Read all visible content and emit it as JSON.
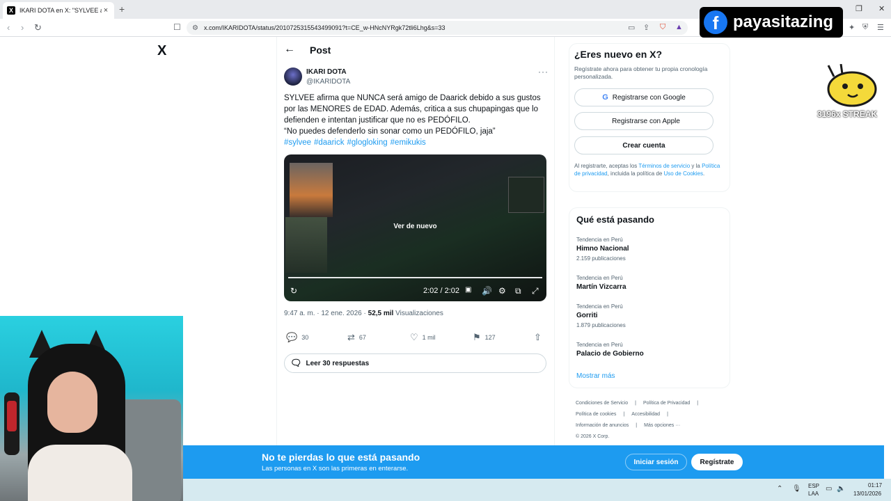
{
  "browser": {
    "tab_favicon": "X",
    "tab_title": "IKARI DOTA en X: \"SYLVEE afirma",
    "tab_close": "×",
    "new_tab": "+",
    "window_controls": [
      "—",
      "❐",
      "✕"
    ],
    "url": "x.com/IKARIDOTA/status/2010725315543499091?t=CE_w-HNcNYRgk72tli6Lhg&s=33"
  },
  "overlay": {
    "fb_letter": "f",
    "fb_name": "payasitazing",
    "streak": "3196x STREAK"
  },
  "x": {
    "logo": "X",
    "header": "Post",
    "author_name": "IKARI DOTA",
    "author_handle": "@IKARIDOTA",
    "more": "···",
    "text_lines": [
      "SYLVEE afirma que NUNCA será amigo de Daarick debido a sus gustos",
      "por las MENORES de EDAD. Además, critica a sus chupapingas que lo",
      "defienden e intentan justificar que no es PEDÓFILO.",
      "“No puedes defenderlo sin sonar como un PEDÓFILO, jaja”"
    ],
    "hashtags": [
      "#sylvee",
      "#daarick",
      "#glogloking",
      "#emikukis"
    ],
    "video": {
      "replay_label": "Ver de nuevo",
      "time": "2:02 / 2:02"
    },
    "meta_time": "9:47 a. m. · 12 ene. 2026 · ",
    "meta_views_count": "52,5 mil",
    "meta_views_label": " Visualizaciones",
    "actions": {
      "replies": "30",
      "retweets": "67",
      "likes": "1 mil",
      "bookmarks": "127"
    },
    "read_replies": "Leer 30 respuestas"
  },
  "sidebar": {
    "signup_title": "¿Eres nuevo en X?",
    "signup_sub": "Regístrate ahora para obtener tu propia cronología personalizada.",
    "google_btn": "Registrarse con Google",
    "apple_btn": "Registrarse con Apple",
    "create_btn": "Crear cuenta",
    "legal_1": "Al registrarte, aceptas los ",
    "legal_terms": "Términos de servicio",
    "legal_2": " y la ",
    "legal_privacy": "Política de privacidad",
    "legal_3": ", incluida la política de ",
    "legal_cookies": "Uso de Cookies",
    "legal_4": ".",
    "trends_title": "Qué está pasando",
    "trends": [
      {
        "context": "Tendencia en Perú",
        "name": "Himno Nacional",
        "count": "2.159 publicaciones"
      },
      {
        "context": "Tendencia en Perú",
        "name": "Martín Vizcarra",
        "count": ""
      },
      {
        "context": "Tendencia en Perú",
        "name": "Gorriti",
        "count": "1.879 publicaciones"
      },
      {
        "context": "Tendencia en Perú",
        "name": "Palacio de Gobierno",
        "count": ""
      }
    ],
    "show_more": "Mostrar más",
    "footer": [
      "Condiciones de Servicio",
      "|",
      "Política de Privacidad",
      "|",
      "Política de cookies",
      "|",
      "Accesibilidad",
      "|",
      "Información de anuncios",
      "|",
      "Más opciones ···",
      "© 2026 X Corp."
    ]
  },
  "banner": {
    "title": "No te pierdas lo que está pasando",
    "subtitle": "Las personas en X son las primeras en enterarse.",
    "login": "Iniciar sesión",
    "signup": "Regístrate"
  },
  "taskbar": {
    "lang_top": "ESP",
    "lang_bottom": "LAA",
    "time": "01:17",
    "date": "13/01/2026"
  },
  "colors": {
    "x_blue": "#1d9bf0",
    "banner": "#1d9bf0",
    "facebook": "#1877f2"
  }
}
